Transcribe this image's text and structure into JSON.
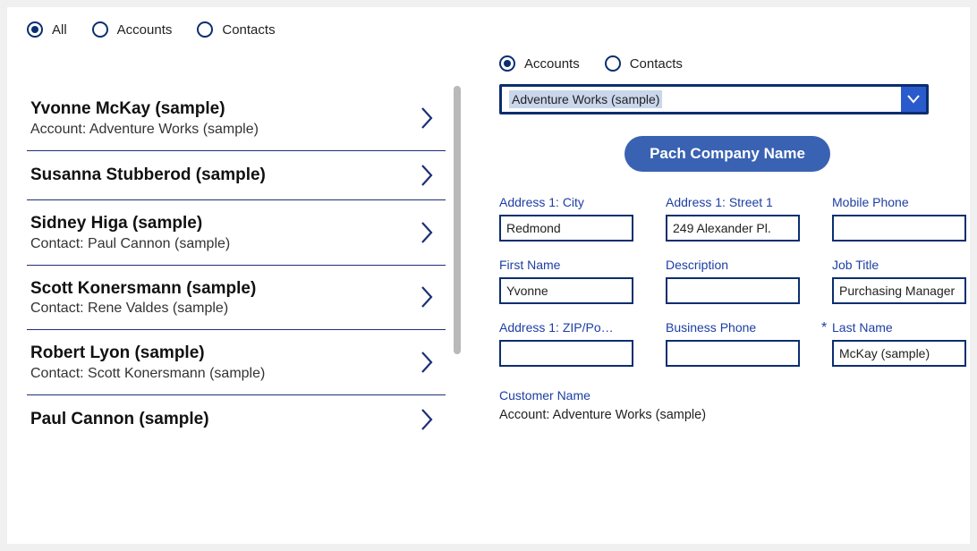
{
  "topFilters": {
    "all": "All",
    "accounts": "Accounts",
    "contacts": "Contacts",
    "selected": "all"
  },
  "list": [
    {
      "title": "Yvonne McKay (sample)",
      "sub": "Account: Adventure Works (sample)"
    },
    {
      "title": "Susanna Stubberod (sample)",
      "sub": ""
    },
    {
      "title": "Sidney Higa (sample)",
      "sub": "Contact: Paul Cannon (sample)"
    },
    {
      "title": "Scott Konersmann (sample)",
      "sub": "Contact: Rene Valdes (sample)"
    },
    {
      "title": "Robert Lyon (sample)",
      "sub": "Contact: Scott Konersmann (sample)"
    },
    {
      "title": "Paul Cannon (sample)",
      "sub": ""
    }
  ],
  "detail": {
    "radios": {
      "accounts": "Accounts",
      "contacts": "Contacts",
      "selected": "accounts"
    },
    "dropdown": "Adventure Works (sample)",
    "actionLabel": "Pach Company Name",
    "fields": {
      "city": {
        "label": "Address 1: City",
        "value": "Redmond"
      },
      "street": {
        "label": "Address 1: Street 1",
        "value": "249 Alexander Pl."
      },
      "mobile": {
        "label": "Mobile Phone",
        "value": ""
      },
      "first": {
        "label": "First Name",
        "value": "Yvonne"
      },
      "desc": {
        "label": "Description",
        "value": ""
      },
      "jobtitle": {
        "label": "Job Title",
        "value": "Purchasing Manager"
      },
      "zip": {
        "label": "Address 1: ZIP/Po…",
        "value": ""
      },
      "busphone": {
        "label": "Business Phone",
        "value": ""
      },
      "last": {
        "label": "Last Name",
        "value": "McKay (sample)",
        "required": true
      }
    },
    "customer": {
      "label": "Customer Name",
      "value": "Account: Adventure Works (sample)"
    }
  }
}
